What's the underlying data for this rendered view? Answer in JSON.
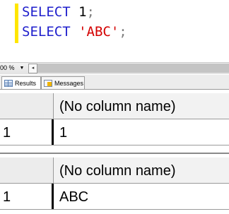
{
  "editor": {
    "line1": {
      "keyword": "SELECT",
      "value": "1",
      "terminator": ";"
    },
    "line2": {
      "keyword": "SELECT",
      "value": "'ABC'",
      "terminator": ";"
    }
  },
  "zoom": {
    "value": "00 %",
    "arrow": "▼",
    "scroll_left": "◂"
  },
  "tabs": [
    {
      "label": "Results"
    },
    {
      "label": "Messages"
    }
  ],
  "results": [
    {
      "header": "(No column name)",
      "row_number": "1",
      "value": "1"
    },
    {
      "header": "(No column name)",
      "row_number": "1",
      "value": "ABC"
    }
  ],
  "colors": {
    "keyword": "#1f1fcc",
    "string": "#d40000",
    "change_bar": "#ffe600"
  }
}
